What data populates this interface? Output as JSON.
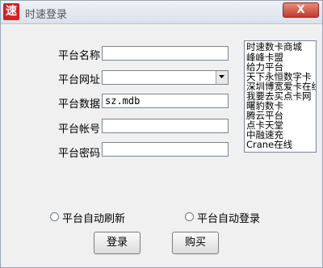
{
  "window": {
    "title": "时速登录",
    "app_icon": "速",
    "close_glyph": "X"
  },
  "form": {
    "platform_name": {
      "label": "平台名称",
      "value": ""
    },
    "platform_url": {
      "label": "平台网址",
      "value": ""
    },
    "platform_data": {
      "label": "平台数据",
      "value": "sz.mdb"
    },
    "platform_account": {
      "label": "平台帐号",
      "value": ""
    },
    "platform_password": {
      "label": "平台密码",
      "value": ""
    }
  },
  "platform_list": [
    "时速数卡商城",
    "峰峰卡盟",
    "给力平台",
    "天下永恒数字卡",
    "深圳博宽爱卡在线",
    "我要去买点卡网",
    "曙豹数卡",
    "腾云平台",
    "点卡天堂",
    "中融速充",
    "Crane在线"
  ],
  "options": {
    "auto_refresh_label": "平台自动刷新",
    "auto_login_label": "平台自动登录"
  },
  "buttons": {
    "login_label": "登录",
    "buy_label": "购买"
  }
}
